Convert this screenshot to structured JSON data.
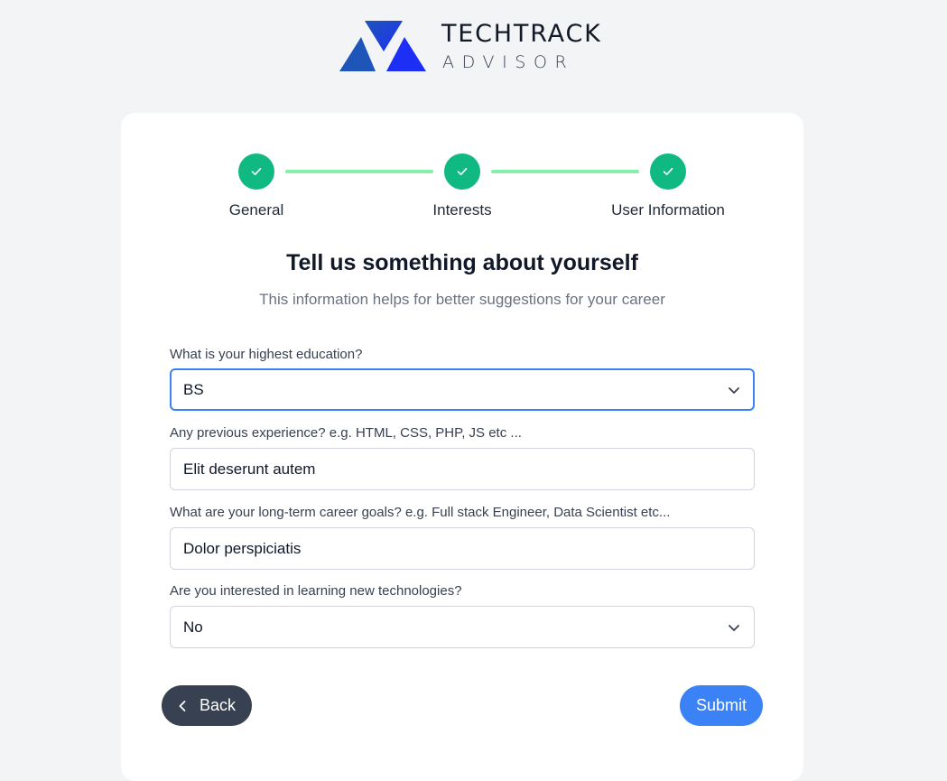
{
  "brand": {
    "name_line1": "TECHTRACK",
    "name_line2": "ADVISOR",
    "colors": {
      "mark_primary": "#1d2ff5",
      "mark_secondary": "#1e55b8"
    }
  },
  "stepper": {
    "steps": [
      {
        "label": "General",
        "status": "completed"
      },
      {
        "label": "Interests",
        "status": "completed"
      },
      {
        "label": "User Information",
        "status": "completed"
      }
    ],
    "colors": {
      "completed": "#10b981",
      "connector": "#86efac"
    }
  },
  "form": {
    "heading": "Tell us something about yourself",
    "subheading": "This information helps for better suggestions for your career",
    "fields": [
      {
        "label": "What is your highest education?",
        "type": "select",
        "value": "BS"
      },
      {
        "label": "Any previous experience? e.g. HTML, CSS, PHP, JS etc ...",
        "type": "text",
        "value": "Elit deserunt autem"
      },
      {
        "label": "What are your long-term career goals? e.g. Full stack Engineer, Data Scientist etc...",
        "type": "text",
        "value": "Dolor perspiciatis"
      },
      {
        "label": "Are you interested in learning new technologies?",
        "type": "select",
        "value": "No"
      }
    ]
  },
  "actions": {
    "back_label": "Back",
    "submit_label": "Submit",
    "colors": {
      "back": "#374151",
      "submit": "#3b82f6"
    }
  }
}
